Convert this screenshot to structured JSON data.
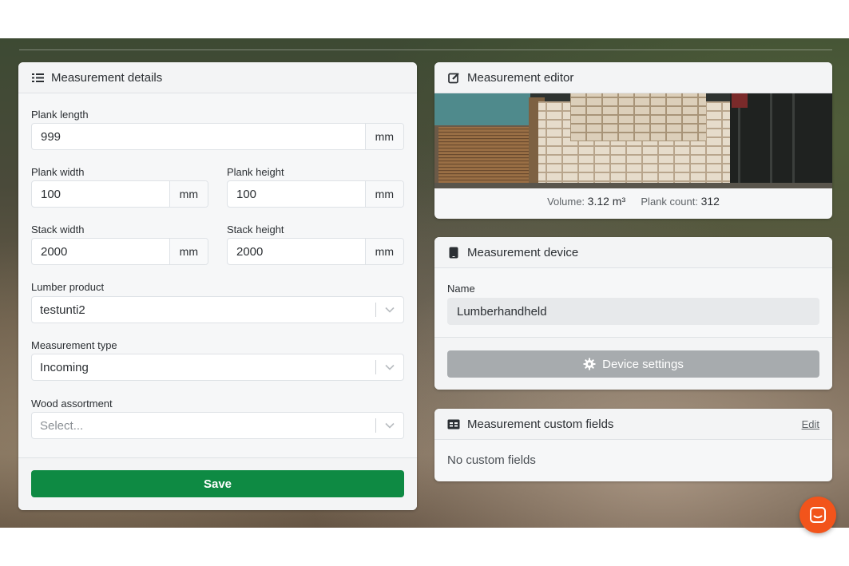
{
  "details": {
    "title": "Measurement details",
    "plank_length": {
      "label": "Plank length",
      "value": "999",
      "unit": "mm"
    },
    "plank_width": {
      "label": "Plank width",
      "value": "100",
      "unit": "mm"
    },
    "plank_height": {
      "label": "Plank height",
      "value": "100",
      "unit": "mm"
    },
    "stack_width": {
      "label": "Stack width",
      "value": "2000",
      "unit": "mm"
    },
    "stack_height": {
      "label": "Stack height",
      "value": "2000",
      "unit": "mm"
    },
    "lumber_product": {
      "label": "Lumber product",
      "value": "testunti2"
    },
    "measurement_type": {
      "label": "Measurement type",
      "value": "Incoming"
    },
    "wood_assortment": {
      "label": "Wood assortment",
      "placeholder": "Select..."
    },
    "save_label": "Save"
  },
  "editor": {
    "title": "Measurement editor",
    "volume_label": "Volume:",
    "volume_value": "3.12 m³",
    "plank_count_label": "Plank count:",
    "plank_count_value": "312"
  },
  "device": {
    "title": "Measurement device",
    "name_label": "Name",
    "name_value": "Lumberhandheld",
    "settings_label": "Device settings"
  },
  "custom_fields": {
    "title": "Measurement custom fields",
    "edit_label": "Edit",
    "empty_text": "No custom fields"
  },
  "colors": {
    "primary": "#0e8a43",
    "chat": "#f2541b",
    "disabled": "#a7abae"
  },
  "icons": [
    "list-icon",
    "edit-icon",
    "tablet-icon",
    "gear-icon",
    "id-card-icon",
    "chevron-down-icon",
    "chat-icon"
  ]
}
